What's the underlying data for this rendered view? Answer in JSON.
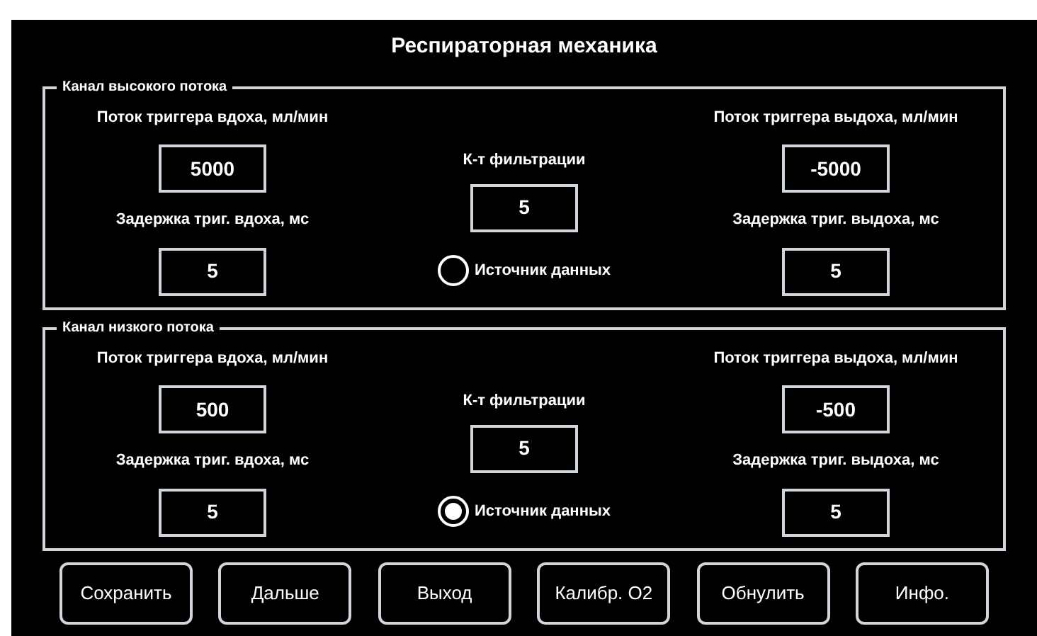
{
  "title": "Респираторная механика",
  "groups": [
    {
      "legend": "Канал высокого потока",
      "inhale_flow": {
        "label": "Поток триггера вдоха, мл/мин",
        "value": "5000"
      },
      "inhale_delay": {
        "label": "Задержка триг. вдоха, мс",
        "value": "5"
      },
      "filter": {
        "label": "К-т фильтрации",
        "value": "5"
      },
      "source": {
        "label": "Источник данных",
        "selected": false
      },
      "exhale_flow": {
        "label": "Поток триггера выдоха, мл/мин",
        "value": "-5000"
      },
      "exhale_delay": {
        "label": "Задержка триг. выдоха, мс",
        "value": "5"
      }
    },
    {
      "legend": "Канал низкого потока",
      "inhale_flow": {
        "label": "Поток триггера вдоха, мл/мин",
        "value": "500"
      },
      "inhale_delay": {
        "label": "Задержка триг. вдоха, мс",
        "value": "5"
      },
      "filter": {
        "label": "К-т фильтрации",
        "value": "5"
      },
      "source": {
        "label": "Источник данных",
        "selected": true
      },
      "exhale_flow": {
        "label": "Поток триггера выдоха, мл/мин",
        "value": "-500"
      },
      "exhale_delay": {
        "label": "Задержка триг. выдоха, мс",
        "value": "5"
      }
    }
  ],
  "buttons": [
    "Сохранить",
    "Дальше",
    "Выход",
    "Калибр. О2",
    "Обнулить",
    "Инфо."
  ]
}
